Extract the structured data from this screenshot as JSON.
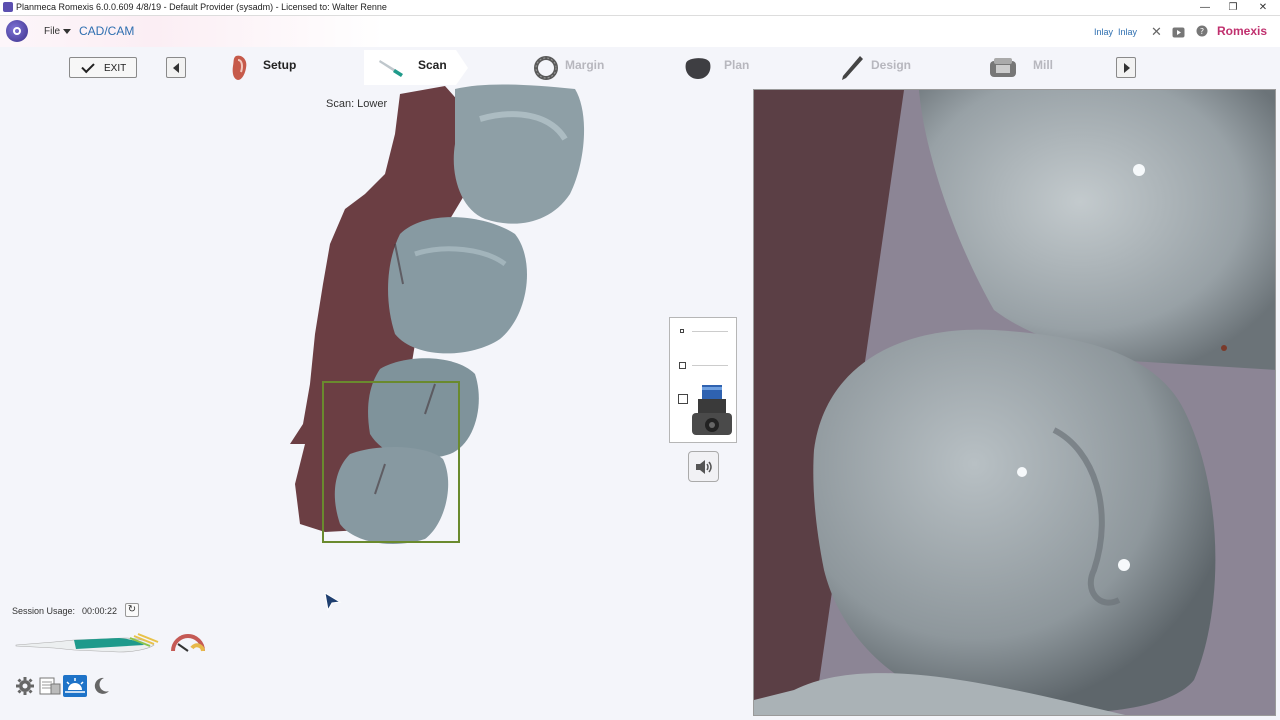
{
  "window": {
    "title": "Planmeca Romexis 6.0.0.609 4/8/19 - Default Provider (sysadm) - Licensed to: Walter Renne",
    "controls": [
      "—",
      "❐",
      "✕"
    ]
  },
  "menubar": {
    "file_label": "File",
    "module_label": "CAD/CAM",
    "restoration_labels": [
      "Inlay",
      "Inlay"
    ],
    "brand": "Romexis"
  },
  "toolbar": {
    "exit_label": "EXIT",
    "steps": [
      {
        "label": "Setup",
        "state": "done"
      },
      {
        "label": "Scan",
        "state": "active"
      },
      {
        "label": "Margin",
        "state": "inactive"
      },
      {
        "label": "Plan",
        "state": "inactive"
      },
      {
        "label": "Design",
        "state": "inactive"
      },
      {
        "label": "Mill",
        "state": "inactive"
      }
    ]
  },
  "scan": {
    "label": "Scan: Lower"
  },
  "status": {
    "session_label": "Session Usage:",
    "session_time": "00:00:22"
  },
  "colors": {
    "accent_blue": "#2e6fb0",
    "brand_magenta": "#c0306e",
    "selection_green": "#6a8a2e"
  },
  "icons": {
    "bottom_tools": [
      "gear-icon",
      "report-icon",
      "sunrise-icon",
      "moon-icon"
    ]
  }
}
